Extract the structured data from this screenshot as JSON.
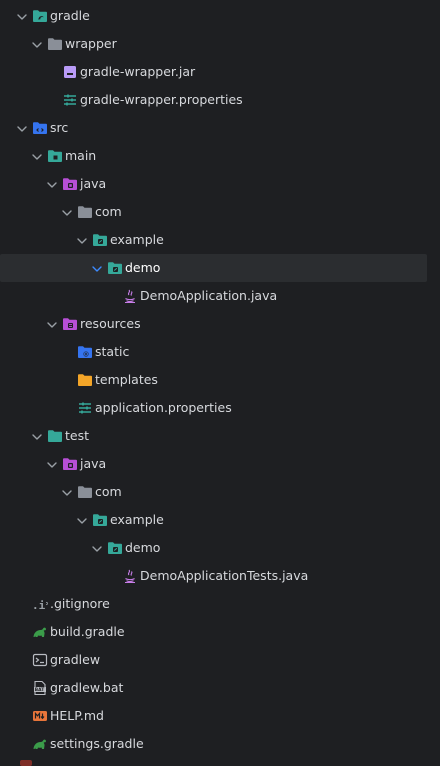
{
  "tree": {
    "rows": [
      {
        "label": "gradle",
        "depth": 0,
        "expanded": true,
        "icon": "folder-gradle-icon",
        "selected": false
      },
      {
        "label": "wrapper",
        "depth": 1,
        "expanded": true,
        "icon": "folder-icon",
        "selected": false
      },
      {
        "label": "gradle-wrapper.jar",
        "depth": 2,
        "expanded": null,
        "icon": "jar-icon",
        "selected": false
      },
      {
        "label": "gradle-wrapper.properties",
        "depth": 2,
        "expanded": null,
        "icon": "properties-icon",
        "selected": false
      },
      {
        "label": "src",
        "depth": 0,
        "expanded": true,
        "icon": "folder-src-icon",
        "selected": false
      },
      {
        "label": "main",
        "depth": 1,
        "expanded": true,
        "icon": "folder-module-icon",
        "selected": false
      },
      {
        "label": "java",
        "depth": 2,
        "expanded": true,
        "icon": "folder-java-source-icon",
        "selected": false
      },
      {
        "label": "com",
        "depth": 3,
        "expanded": true,
        "icon": "folder-icon",
        "selected": false
      },
      {
        "label": "example",
        "depth": 4,
        "expanded": true,
        "icon": "package-icon",
        "selected": false
      },
      {
        "label": "demo",
        "depth": 5,
        "expanded": true,
        "icon": "package-icon",
        "selected": true
      },
      {
        "label": "DemoApplication.java",
        "depth": 6,
        "expanded": null,
        "icon": "java-class-icon",
        "selected": false
      },
      {
        "label": "resources",
        "depth": 2,
        "expanded": true,
        "icon": "folder-resources-icon",
        "selected": false
      },
      {
        "label": "static",
        "depth": 3,
        "expanded": null,
        "icon": "folder-web-icon",
        "selected": false
      },
      {
        "label": "templates",
        "depth": 3,
        "expanded": null,
        "icon": "folder-templates-icon",
        "selected": false
      },
      {
        "label": "application.properties",
        "depth": 3,
        "expanded": null,
        "icon": "properties-icon",
        "selected": false
      },
      {
        "label": "test",
        "depth": 1,
        "expanded": true,
        "icon": "folder-test-icon",
        "selected": false
      },
      {
        "label": "java",
        "depth": 2,
        "expanded": true,
        "icon": "folder-java-source-icon",
        "selected": false
      },
      {
        "label": "com",
        "depth": 3,
        "expanded": true,
        "icon": "folder-icon",
        "selected": false
      },
      {
        "label": "example",
        "depth": 4,
        "expanded": true,
        "icon": "package-icon",
        "selected": false
      },
      {
        "label": "demo",
        "depth": 5,
        "expanded": true,
        "icon": "package-icon",
        "selected": false
      },
      {
        "label": "DemoApplicationTests.java",
        "depth": 6,
        "expanded": null,
        "icon": "java-class-icon",
        "selected": false
      },
      {
        "label": ".gitignore",
        "depth": 0,
        "expanded": null,
        "icon": "gitignore-icon",
        "selected": false
      },
      {
        "label": "build.gradle",
        "depth": 0,
        "expanded": null,
        "icon": "gradle-icon",
        "selected": false
      },
      {
        "label": "gradlew",
        "depth": 0,
        "expanded": null,
        "icon": "terminal-icon",
        "selected": false
      },
      {
        "label": "gradlew.bat",
        "depth": 0,
        "expanded": null,
        "icon": "bat-file-icon",
        "selected": false
      },
      {
        "label": "HELP.md",
        "depth": 0,
        "expanded": null,
        "icon": "markdown-icon",
        "selected": false
      },
      {
        "label": "settings.gradle",
        "depth": 0,
        "expanded": null,
        "icon": "gradle-icon",
        "selected": false
      }
    ]
  },
  "colors": {
    "background": "#1e1f22",
    "selection": "#2b2d30",
    "text": "#d7d9dd",
    "chevron": "#9aa0a6",
    "chevron_selected": "#3d8bff",
    "folder": "#8a8f98",
    "folder_blue": "#3574f0",
    "folder_teal": "#35a899",
    "folder_purple": "#b74fd6",
    "folder_yellow": "#f4a528",
    "gradle_green": "#3b9c4a",
    "markdown_orange": "#e8753a"
  }
}
